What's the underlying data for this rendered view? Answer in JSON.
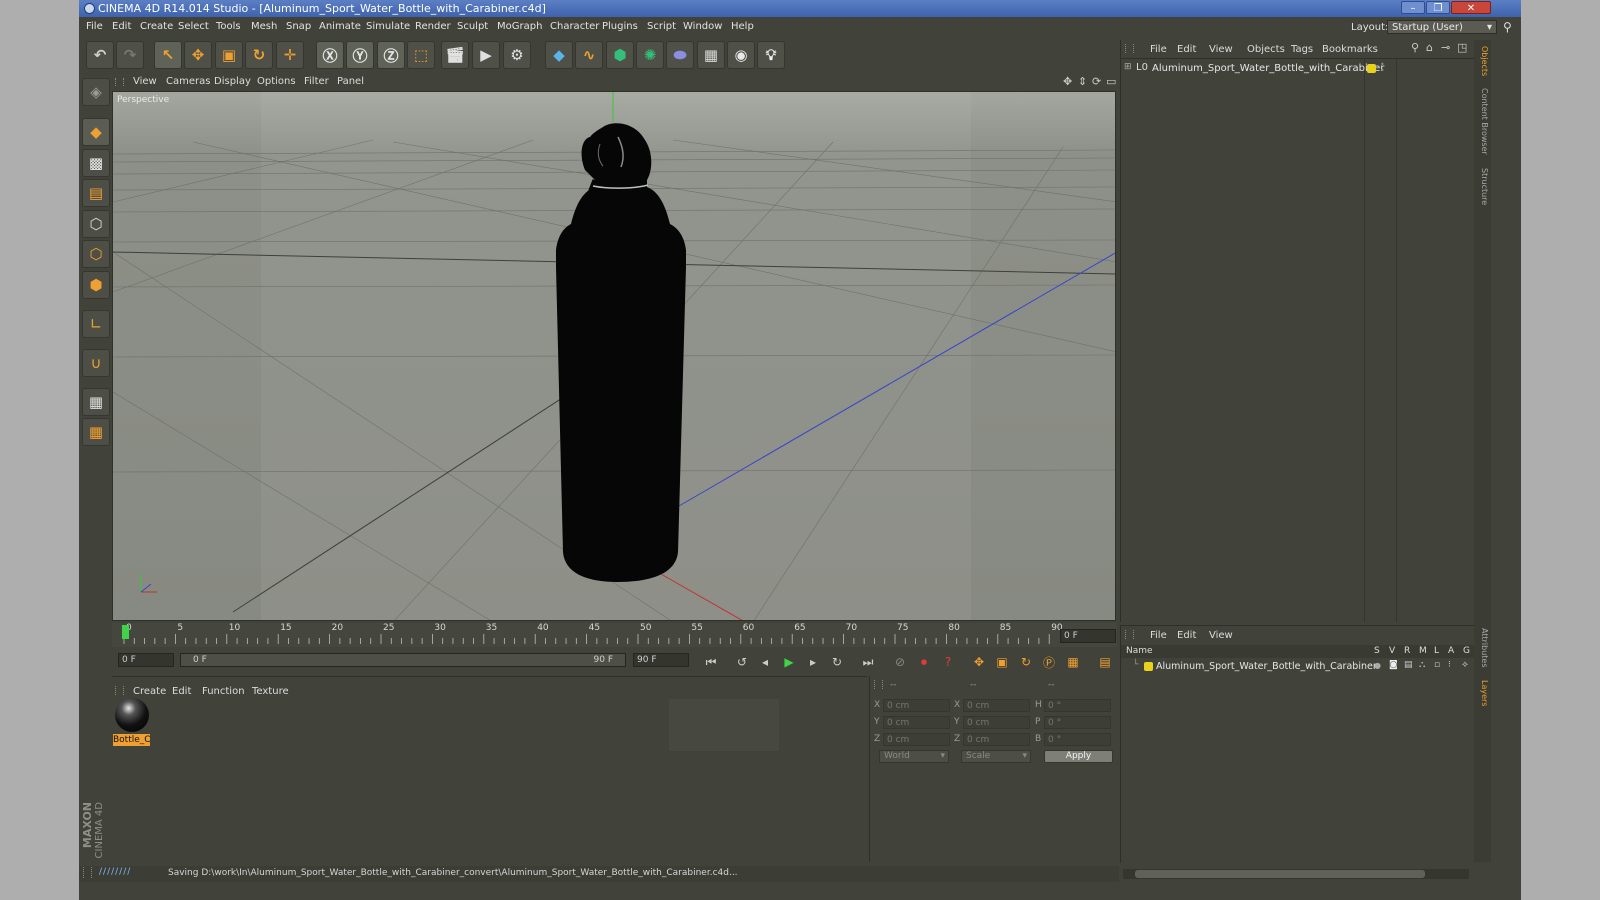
{
  "window": {
    "title": "CINEMA 4D R14.014 Studio - [Aluminum_Sport_Water_Bottle_with_Carabiner.c4d]",
    "controls": [
      "–",
      "❐",
      "✕"
    ]
  },
  "menubar": {
    "items": [
      "File",
      "Edit",
      "Create",
      "Select",
      "Tools",
      "Mesh",
      "Snap",
      "Animate",
      "Simulate",
      "Render",
      "Sculpt",
      "MoGraph",
      "Character",
      "Plugins",
      "Script",
      "Window",
      "Help"
    ],
    "layout_label": "Layout:",
    "layout_value": "Startup (User)"
  },
  "viewport": {
    "menu": [
      "View",
      "Cameras",
      "Display",
      "Options",
      "Filter",
      "Panel"
    ],
    "label": "Perspective"
  },
  "timeline": {
    "ticks": [
      "0",
      "5",
      "10",
      "15",
      "20",
      "25",
      "30",
      "35",
      "40",
      "45",
      "50",
      "55",
      "60",
      "65",
      "70",
      "75",
      "80",
      "85",
      "90"
    ],
    "current_frame": "0 F",
    "start_field": "0 F",
    "range_start": "0 F",
    "range_end": "90 F",
    "end_field": "90 F"
  },
  "materials": {
    "menu": [
      "Create",
      "Edit",
      "Function",
      "Texture"
    ],
    "items": [
      {
        "name": "Bottle_C"
      }
    ]
  },
  "attributes": {
    "header": [
      "--",
      "--",
      "--"
    ],
    "rows": [
      {
        "a": "X",
        "av": "0 cm",
        "b": "X",
        "bv": "0 cm",
        "c": "H",
        "cv": "0 °"
      },
      {
        "a": "Y",
        "av": "0 cm",
        "b": "Y",
        "bv": "0 cm",
        "c": "P",
        "cv": "0 °"
      },
      {
        "a": "Z",
        "av": "0 cm",
        "b": "Z",
        "bv": "0 cm",
        "c": "B",
        "cv": "0 °"
      }
    ],
    "coord_mode": "World",
    "scale_mode": "Scale",
    "apply_label": "Apply"
  },
  "object_manager": {
    "menu": [
      "File",
      "Edit",
      "View",
      "Objects",
      "Tags",
      "Bookmarks"
    ],
    "object_name": "Aluminum_Sport_Water_Bottle_with_Carabiner"
  },
  "layer_manager": {
    "menu": [
      "File",
      "Edit",
      "View"
    ],
    "name_header": "Name",
    "flag_headers": [
      "S",
      "V",
      "R",
      "M",
      "L",
      "A",
      "G"
    ],
    "layer_name": "Aluminum_Sport_Water_Bottle_with_Carabiner"
  },
  "side_tabs": [
    "Objects",
    "Content Browser",
    "Structure",
    "Attributes",
    "Layers"
  ],
  "status": {
    "text": "Saving D:\\work\\In\\Aluminum_Sport_Water_Bottle_with_Carabiner_convert\\Aluminum_Sport_Water_Bottle_with_Carabiner.c4d..."
  },
  "branding": {
    "line1": "MAXON",
    "line2": "CINEMA 4D"
  },
  "colors": {
    "accent_orange": "#f0a030",
    "layer_yellow": "#e8d21c",
    "timeline_green": "#3fd34a"
  }
}
